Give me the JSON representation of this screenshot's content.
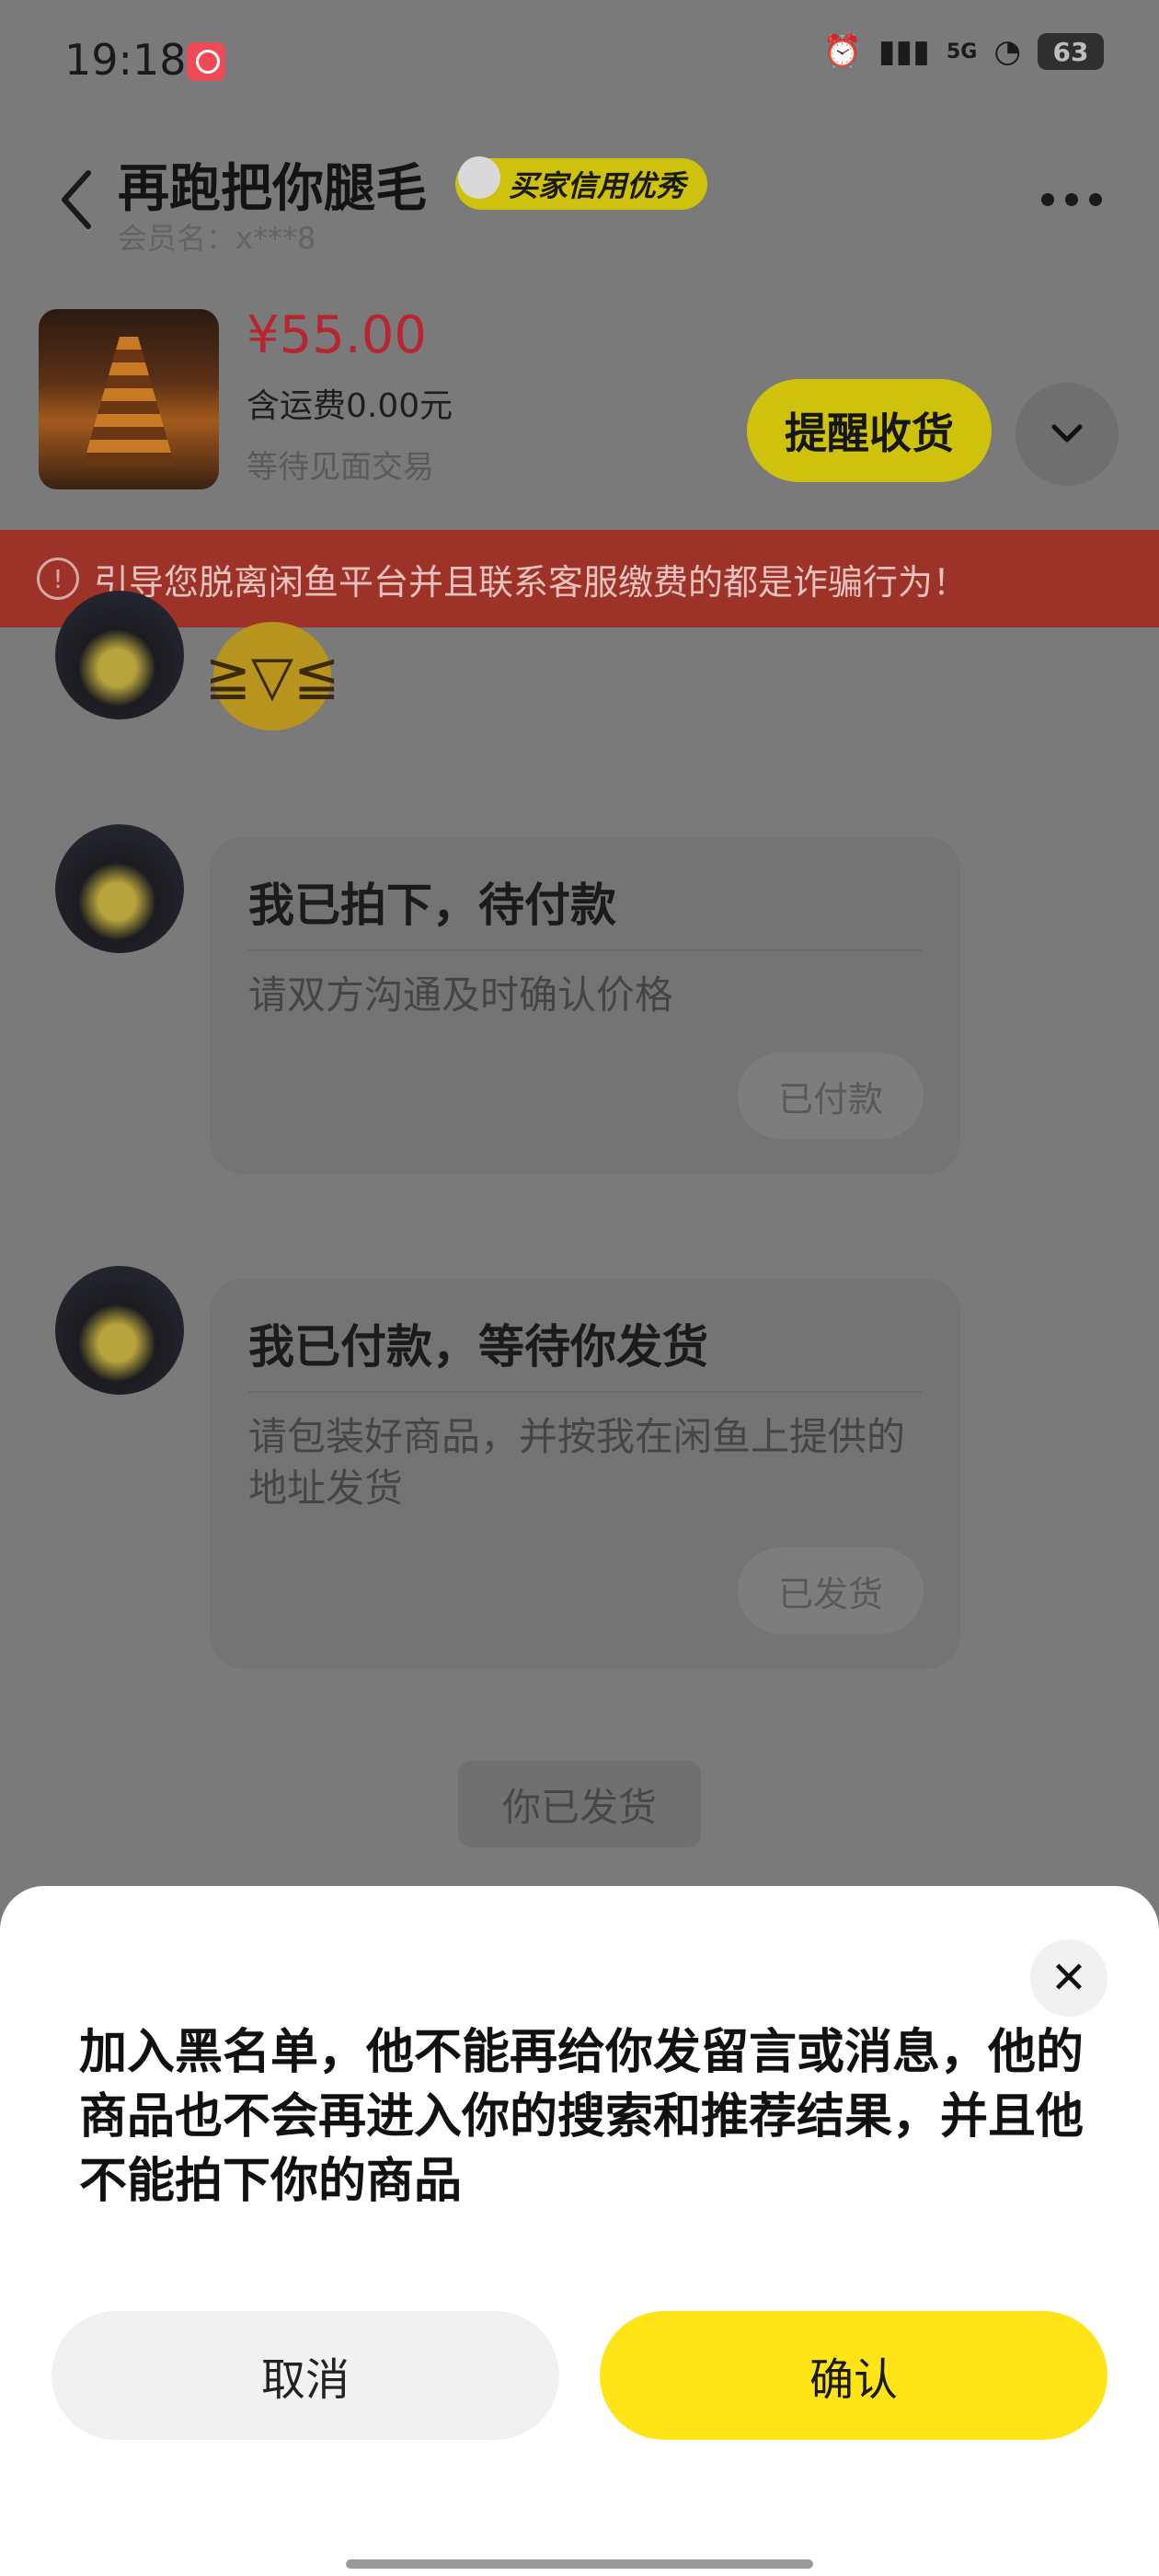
{
  "status_bar": {
    "time": "19:18",
    "network": "5G",
    "battery": "63"
  },
  "header": {
    "title": "再跑把你腿毛",
    "badge": "买家信用优秀",
    "member": "会员名：x***8"
  },
  "product": {
    "price": "¥55.00",
    "shipping": "含运费0.00元",
    "status": "等待见面交易",
    "remind_button": "提醒收货"
  },
  "warning": {
    "text": "引导您脱离闲鱼平台并且联系客服缴费的都是诈骗行为！"
  },
  "chat": {
    "cards": [
      {
        "title": "我已拍下，待付款",
        "desc": "请双方沟通及时确认价格",
        "button": "已付款"
      },
      {
        "title": "我已付款，等待你发货",
        "desc": "请包装好商品，并按我在闲鱼上提供的地址发货",
        "button": "已发货"
      }
    ],
    "system_note": "你已发货"
  },
  "dialog": {
    "message": "加入黑名单，他不能再给你发留言或消息，他的商品也不会再进入你的搜索和推荐结果，并且他不能拍下你的商品",
    "cancel": "取消",
    "confirm": "确认"
  },
  "icons": [
    "back-icon",
    "more-icon",
    "chevron-down-icon",
    "warning-icon",
    "close-icon",
    "alarm-icon",
    "wifi-icon",
    "signal-icon"
  ]
}
